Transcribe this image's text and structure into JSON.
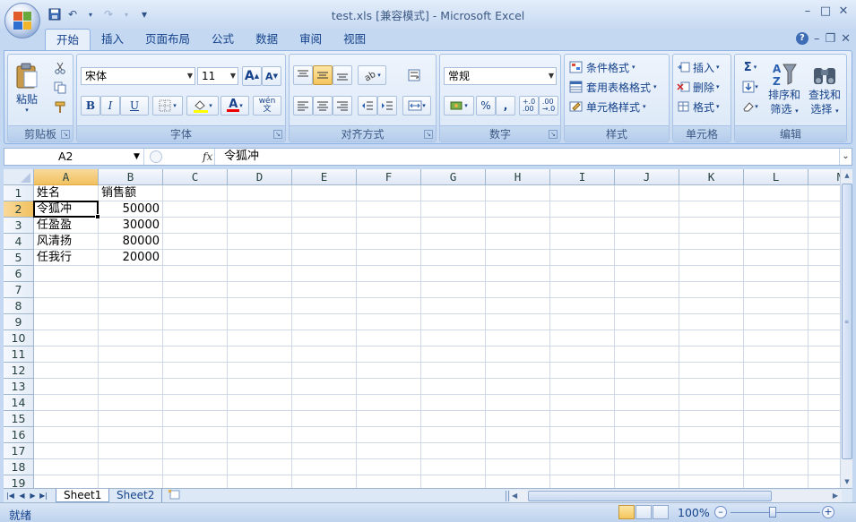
{
  "window": {
    "title": "test.xls  [兼容模式] - Microsoft Excel",
    "minimize": "–",
    "maximize": "□",
    "close": "✕"
  },
  "qat": {
    "save": "💾",
    "undo": "↶",
    "redo": "↷",
    "customize": "▾"
  },
  "tabs": [
    {
      "label": "开始",
      "active": true
    },
    {
      "label": "插入"
    },
    {
      "label": "页面布局"
    },
    {
      "label": "公式"
    },
    {
      "label": "数据"
    },
    {
      "label": "审阅"
    },
    {
      "label": "视图"
    }
  ],
  "ribbon_right": {
    "help": "?",
    "min": "–",
    "restore": "❐",
    "close": "✕"
  },
  "groups": {
    "clipboard": {
      "label": "剪贴板",
      "paste": "粘贴"
    },
    "font": {
      "label": "字体",
      "font_name": "宋体",
      "font_size": "11",
      "bold": "B",
      "italic": "I",
      "underline": "U",
      "grow": "A",
      "shrink": "A",
      "font_color": "A",
      "phonetic": "wén\n文"
    },
    "alignment": {
      "label": "对齐方式"
    },
    "number": {
      "label": "数字",
      "format": "常规",
      "percent": "%",
      "comma": ",",
      "inc_decimal": "+.0\n.00",
      "dec_decimal": ".00\n→.0"
    },
    "styles": {
      "label": "样式",
      "conditional": "条件格式",
      "table": "套用表格格式",
      "cell": "单元格样式"
    },
    "cells": {
      "label": "单元格",
      "insert": "插入",
      "delete": "删除",
      "format": "格式"
    },
    "editing": {
      "label": "编辑",
      "sum": "Σ",
      "sort_line1": "排序和",
      "sort_line2": "筛选",
      "find_line1": "查找和",
      "find_line2": "选择"
    }
  },
  "formula_bar": {
    "name_box": "A2",
    "fx": "fx",
    "content": "令狐冲"
  },
  "columns": [
    "A",
    "B",
    "C",
    "D",
    "E",
    "F",
    "G",
    "H",
    "I",
    "J",
    "K",
    "L",
    "M"
  ],
  "rows": [
    "1",
    "2",
    "3",
    "4",
    "5",
    "6",
    "7",
    "8",
    "9",
    "10",
    "11",
    "12",
    "13",
    "14",
    "15",
    "16",
    "17",
    "18",
    "19"
  ],
  "cells": [
    {
      "row": 1,
      "col": "A",
      "value": "姓名"
    },
    {
      "row": 1,
      "col": "B",
      "value": "销售额"
    },
    {
      "row": 2,
      "col": "A",
      "value": "令狐冲"
    },
    {
      "row": 2,
      "col": "B",
      "value": "50000",
      "num": true
    },
    {
      "row": 3,
      "col": "A",
      "value": "任盈盈"
    },
    {
      "row": 3,
      "col": "B",
      "value": "30000",
      "num": true
    },
    {
      "row": 4,
      "col": "A",
      "value": "风清扬"
    },
    {
      "row": 4,
      "col": "B",
      "value": "80000",
      "num": true
    },
    {
      "row": 5,
      "col": "A",
      "value": "任我行"
    },
    {
      "row": 5,
      "col": "B",
      "value": "20000",
      "num": true
    }
  ],
  "selected": {
    "row": 2,
    "col": "A"
  },
  "sheets": [
    {
      "label": "Sheet1",
      "active": true
    },
    {
      "label": "Sheet2"
    }
  ],
  "status": {
    "text": "就绪",
    "zoom": "100%",
    "zoom_out": "–",
    "zoom_in": "+"
  }
}
